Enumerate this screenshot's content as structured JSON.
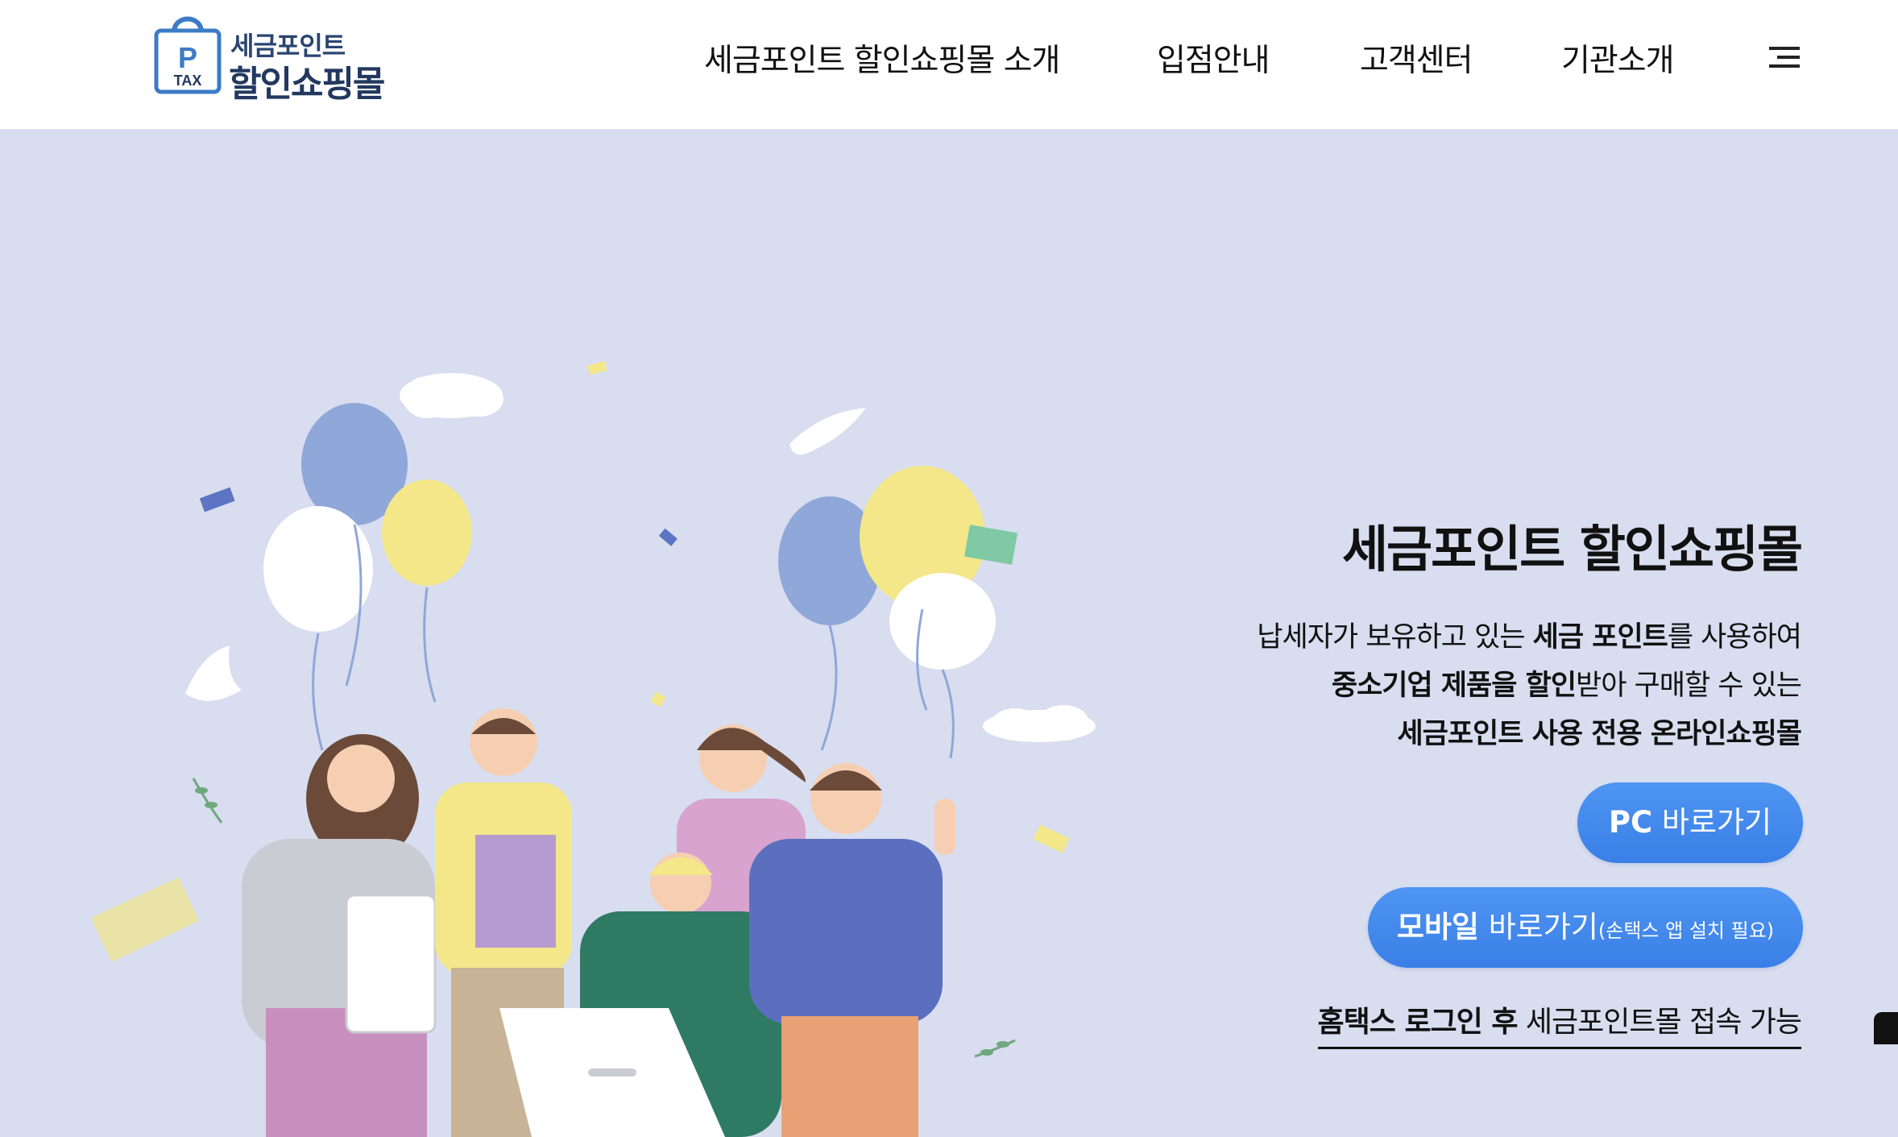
{
  "header": {
    "logo": {
      "badge_letter": "P",
      "badge_text": "TAX",
      "line1": "세금포인트",
      "line2": "할인쇼핑몰"
    },
    "nav": [
      {
        "label": "세금포인트 할인쇼핑몰 소개"
      },
      {
        "label": "입점안내"
      },
      {
        "label": "고객센터"
      },
      {
        "label": "기관소개"
      }
    ],
    "menu_icon": "hamburger-icon"
  },
  "hero": {
    "title": "세금포인트 할인쇼핑몰",
    "desc": {
      "line1_a": "납세자가 보유하고 있는 ",
      "line1_b": "세금 포인트",
      "line1_c": "를 사용하여",
      "line2_a": "중소기업 제품을 할인",
      "line2_b": "받아 구매할 수 있는",
      "line3": "세금포인트 사용 전용 온라인쇼핑몰"
    },
    "pc_button": {
      "bold": "PC",
      "label": " 바로가기"
    },
    "mobile_button": {
      "bold": "모바일",
      "label": " 바로가기",
      "note": "(손택스 앱 설치 필요)"
    },
    "hometax_link": {
      "bold": "홈택스 로그인 후",
      "label": " 세금포인트몰 접속 가능"
    }
  },
  "colors": {
    "background": "#d8ddef",
    "button": "#3f86ec",
    "logo": "#22385f"
  }
}
